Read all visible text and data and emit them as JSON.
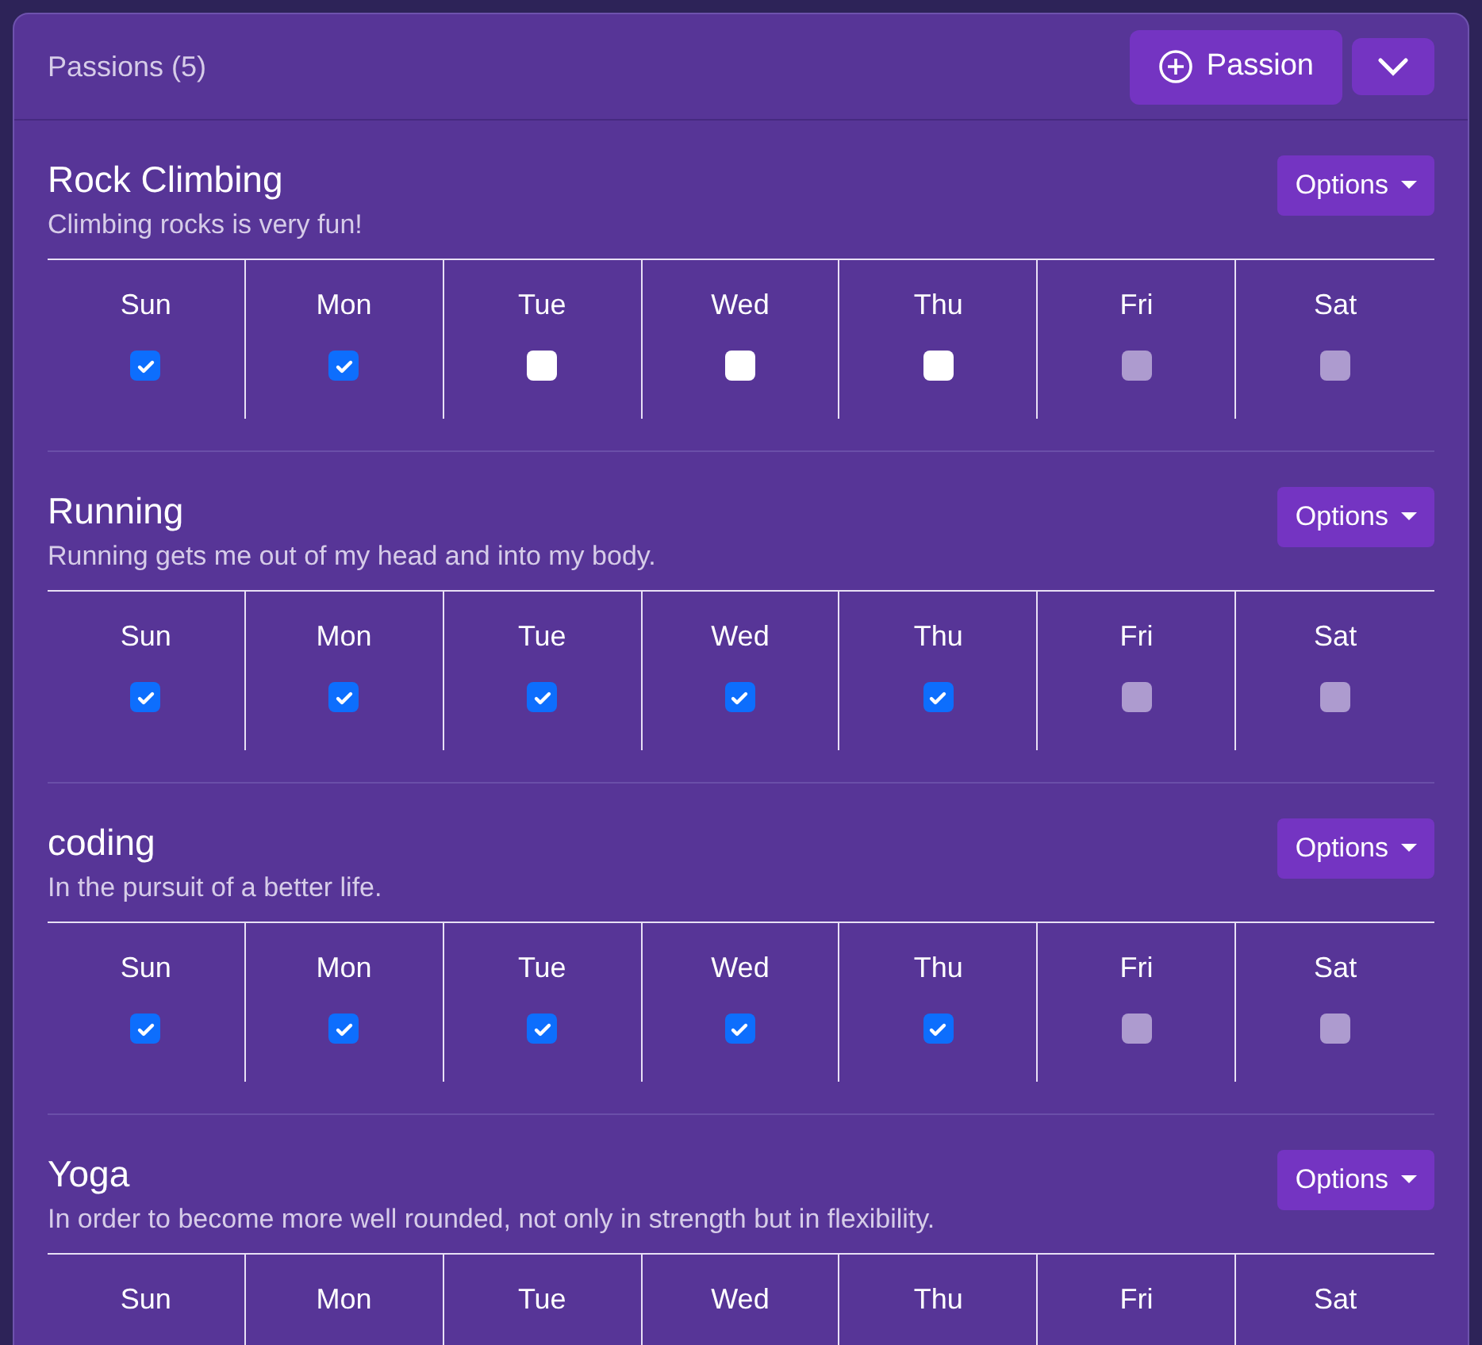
{
  "header": {
    "title": "Passions (5)",
    "add_button": "Passion"
  },
  "passions": [
    {
      "name": "Rock Climbing",
      "description": "Climbing rocks is very fun!",
      "options": "Options",
      "days": [
        {
          "label": "Sun",
          "checked": true,
          "disabled": false
        },
        {
          "label": "Mon",
          "checked": true,
          "disabled": false
        },
        {
          "label": "Tue",
          "checked": false,
          "disabled": false
        },
        {
          "label": "Wed",
          "checked": false,
          "disabled": false
        },
        {
          "label": "Thu",
          "checked": false,
          "disabled": false
        },
        {
          "label": "Fri",
          "checked": false,
          "disabled": true
        },
        {
          "label": "Sat",
          "checked": false,
          "disabled": true
        }
      ]
    },
    {
      "name": "Running",
      "description": "Running gets me out of my head and into my body.",
      "options": "Options",
      "days": [
        {
          "label": "Sun",
          "checked": true,
          "disabled": false
        },
        {
          "label": "Mon",
          "checked": true,
          "disabled": false
        },
        {
          "label": "Tue",
          "checked": true,
          "disabled": false
        },
        {
          "label": "Wed",
          "checked": true,
          "disabled": false
        },
        {
          "label": "Thu",
          "checked": true,
          "disabled": false
        },
        {
          "label": "Fri",
          "checked": false,
          "disabled": true
        },
        {
          "label": "Sat",
          "checked": false,
          "disabled": true
        }
      ]
    },
    {
      "name": "coding",
      "description": "In the pursuit of a better life.",
      "options": "Options",
      "days": [
        {
          "label": "Sun",
          "checked": true,
          "disabled": false
        },
        {
          "label": "Mon",
          "checked": true,
          "disabled": false
        },
        {
          "label": "Tue",
          "checked": true,
          "disabled": false
        },
        {
          "label": "Wed",
          "checked": true,
          "disabled": false
        },
        {
          "label": "Thu",
          "checked": true,
          "disabled": false
        },
        {
          "label": "Fri",
          "checked": false,
          "disabled": true
        },
        {
          "label": "Sat",
          "checked": false,
          "disabled": true
        }
      ]
    },
    {
      "name": "Yoga",
      "description": "In order to become more well rounded, not only in strength but in flexibility.",
      "options": "Options",
      "days": [
        {
          "label": "Sun"
        },
        {
          "label": "Mon"
        },
        {
          "label": "Tue"
        },
        {
          "label": "Wed"
        },
        {
          "label": "Thu"
        },
        {
          "label": "Fri"
        },
        {
          "label": "Sat"
        }
      ]
    }
  ]
}
